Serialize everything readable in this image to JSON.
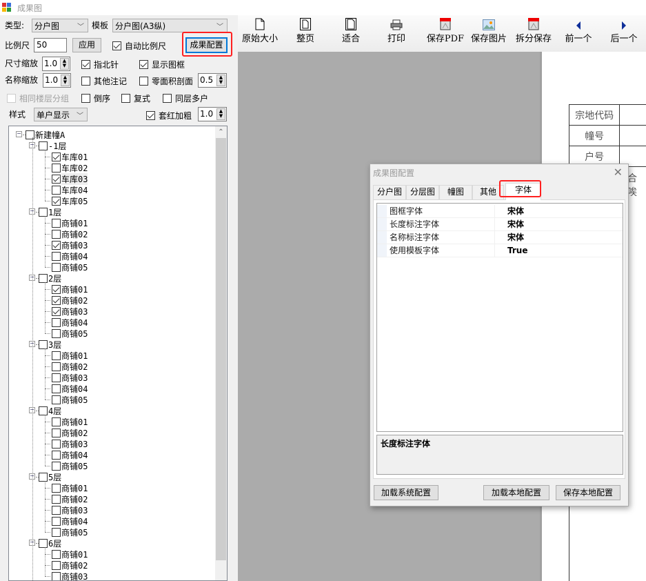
{
  "window": {
    "title": "成果图"
  },
  "controls": {
    "type_label": "类型:",
    "type_value": "分户图",
    "template_label": "模板",
    "template_value": "分户图(A3纵)",
    "scale_label": "比例尺",
    "scale_value": "50",
    "apply_button": "应用",
    "auto_scale": {
      "label": "自动比例尺",
      "checked": true
    },
    "result_config_button": "成果配置",
    "size_zoom_label": "尺寸缩放",
    "size_zoom_value": "1.0",
    "north_arrow": {
      "label": "指北针",
      "checked": true
    },
    "show_frame": {
      "label": "显示图框",
      "checked": true
    },
    "name_zoom_label": "名称缩放",
    "name_zoom_value": "1.0",
    "other_notes": {
      "label": "其他注记",
      "checked": false
    },
    "zero_area_section": {
      "label": "零面积剖面",
      "checked": false
    },
    "zero_area_value": "0.5",
    "same_floor_group": {
      "label": "相同楼层分组",
      "checked": false,
      "disabled": true
    },
    "reverse_order": {
      "label": "倒序",
      "checked": false
    },
    "duplex": {
      "label": "复式",
      "checked": false
    },
    "same_floor_multi": {
      "label": "同层多户",
      "checked": false
    },
    "style_label": "样式",
    "style_value": "单户显示",
    "red_bold": {
      "label": "套红加粗",
      "checked": true
    },
    "red_bold_value": "1.0"
  },
  "tree": {
    "root": {
      "label": "新建幢A",
      "checked": false
    },
    "floors": [
      {
        "label": "-1层",
        "checked": false,
        "items": [
          {
            "label": "车库01",
            "checked": true
          },
          {
            "label": "车库02",
            "checked": false
          },
          {
            "label": "车库03",
            "checked": true,
            "selected": true
          },
          {
            "label": "车库04",
            "checked": false
          },
          {
            "label": "车库05",
            "checked": true
          }
        ]
      },
      {
        "label": "1层",
        "checked": false,
        "items": [
          {
            "label": "商铺01",
            "checked": false
          },
          {
            "label": "商铺02",
            "checked": false
          },
          {
            "label": "商铺03",
            "checked": true
          },
          {
            "label": "商铺04",
            "checked": false
          },
          {
            "label": "商铺05",
            "checked": false
          }
        ]
      },
      {
        "label": "2层",
        "checked": false,
        "items": [
          {
            "label": "商铺01",
            "checked": true
          },
          {
            "label": "商铺02",
            "checked": true
          },
          {
            "label": "商铺03",
            "checked": true
          },
          {
            "label": "商铺04",
            "checked": false
          },
          {
            "label": "商铺05",
            "checked": false
          }
        ]
      },
      {
        "label": "3层",
        "checked": false,
        "items": [
          {
            "label": "商铺01",
            "checked": false
          },
          {
            "label": "商铺02",
            "checked": false
          },
          {
            "label": "商铺03",
            "checked": false
          },
          {
            "label": "商铺04",
            "checked": false
          },
          {
            "label": "商铺05",
            "checked": false
          }
        ]
      },
      {
        "label": "4层",
        "checked": false,
        "items": [
          {
            "label": "商铺01",
            "checked": false
          },
          {
            "label": "商铺02",
            "checked": false
          },
          {
            "label": "商铺03",
            "checked": false
          },
          {
            "label": "商铺04",
            "checked": false
          },
          {
            "label": "商铺05",
            "checked": false
          }
        ]
      },
      {
        "label": "5层",
        "checked": false,
        "items": [
          {
            "label": "商铺01",
            "checked": false
          },
          {
            "label": "商铺02",
            "checked": false
          },
          {
            "label": "商铺03",
            "checked": false
          },
          {
            "label": "商铺04",
            "checked": false
          },
          {
            "label": "商铺05",
            "checked": false
          }
        ]
      },
      {
        "label": "6层",
        "checked": false,
        "items": [
          {
            "label": "商铺01",
            "checked": false
          },
          {
            "label": "商铺02",
            "checked": false
          },
          {
            "label": "商铺03",
            "checked": false
          }
        ]
      }
    ]
  },
  "toolbar": [
    {
      "label": "原始大小",
      "icon": "page-icon"
    },
    {
      "label": "整页",
      "icon": "full-page-icon"
    },
    {
      "label": "适合",
      "icon": "fit-page-icon"
    },
    {
      "label": "打印",
      "icon": "printer-icon"
    },
    {
      "label": "保存PDF",
      "icon": "pdf-icon"
    },
    {
      "label": "保存图片",
      "icon": "image-icon"
    },
    {
      "label": "拆分保存",
      "icon": "pdf-split-icon"
    },
    {
      "label": "前一个",
      "icon": "triangle-left-icon"
    },
    {
      "label": "后一个",
      "icon": "triangle-right-icon"
    }
  ],
  "preview": {
    "table_rows": [
      "宗地代码",
      "幢号",
      "户号"
    ],
    "partial_text": "合唉"
  },
  "dialog": {
    "title": "成果图配置",
    "tabs": [
      "分户图",
      "分层图",
      "幢图",
      "其他",
      "字体"
    ],
    "active_tab": "字体",
    "properties": [
      {
        "name": "图框字体",
        "value": "宋体"
      },
      {
        "name": "长度标注字体",
        "value": "宋体"
      },
      {
        "name": "名称标注字体",
        "value": "宋体"
      },
      {
        "name": "使用模板字体",
        "value": "True"
      }
    ],
    "description": "长度标注字体",
    "buttons": {
      "load_system": "加载系统配置",
      "load_local": "加载本地配置",
      "save_local": "保存本地配置"
    }
  },
  "colors": {
    "highlight": "#ff2020",
    "canvas": "#ababab",
    "focus_border": "#0078d7"
  }
}
